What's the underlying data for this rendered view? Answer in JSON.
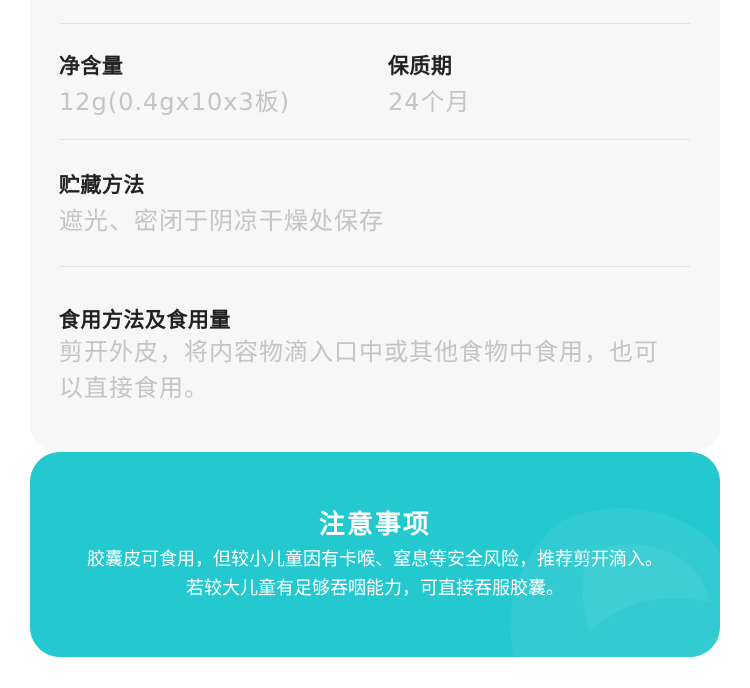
{
  "info": {
    "net_content": {
      "label": "净含量",
      "value": "12g(0.4gx10x3板)"
    },
    "shelf_life": {
      "label": "保质期",
      "value": "24个月"
    },
    "storage": {
      "label": "贮藏方法",
      "value": "遮光、密闭于阴凉干燥处保存"
    },
    "usage": {
      "label": "食用方法及食用量",
      "value": "剪开外皮，将内容物滴入口中或其他食物中食用，也可以直接食用。"
    }
  },
  "notice": {
    "title": "注意事项",
    "line1": "胶囊皮可食用，但较小儿童因有卡喉、窒息等安全风险，推荐剪开滴入。",
    "line2": "若较大儿童有足够吞咽能力，可直接吞服胶囊。"
  },
  "colors": {
    "notice_bg": "#24c8cf",
    "card_bg": "#f7f7f7",
    "label": "#222222",
    "value": "#c4c4c4"
  }
}
